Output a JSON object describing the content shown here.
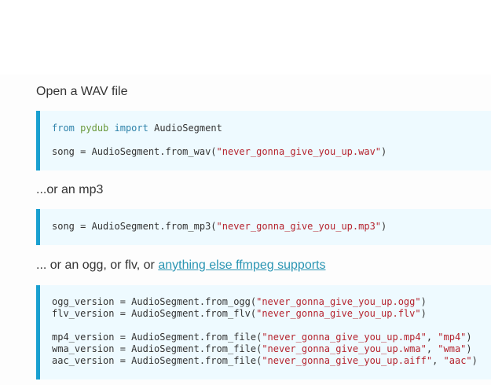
{
  "sections": [
    {
      "intro": "Open a WAV file",
      "code": {
        "kw_from": "from",
        "module": "pydub",
        "kw_import": "import",
        "imported_name": "AudioSegment",
        "line2_prefix": "song = AudioSegment.from_wav(",
        "line2_str": "\"never_gonna_give_you_up.wav\"",
        "line2_suffix": ")"
      }
    },
    {
      "intro": "...or an mp3",
      "code": {
        "line1_prefix": "song = AudioSegment.from_mp3(",
        "line1_str": "\"never_gonna_give_you_up.mp3\"",
        "line1_suffix": ")"
      }
    },
    {
      "intro": "... or an ogg, or flv, or ",
      "link_text": "anything else ffmpeg supports",
      "code": {
        "lines": [
          {
            "prefix": "ogg_version = AudioSegment.from_ogg(",
            "str1": "\"never_gonna_give_you_up.ogg\"",
            "mid": "",
            "str2": "",
            "suffix": ")"
          },
          {
            "prefix": "flv_version = AudioSegment.from_flv(",
            "str1": "\"never_gonna_give_you_up.flv\"",
            "mid": "",
            "str2": "",
            "suffix": ")"
          },
          {
            "prefix": "mp4_version = AudioSegment.from_file(",
            "str1": "\"never_gonna_give_you_up.mp4\"",
            "mid": ", ",
            "str2": "\"mp4\"",
            "suffix": ")"
          },
          {
            "prefix": "wma_version = AudioSegment.from_file(",
            "str1": "\"never_gonna_give_you_up.wma\"",
            "mid": ", ",
            "str2": "\"wma\"",
            "suffix": ")"
          },
          {
            "prefix": "aac_version = AudioSegment.from_file(",
            "str1": "\"never_gonna_give_you_up.aiff\"",
            "mid": ", ",
            "str2": "\"aac\"",
            "suffix": ")"
          }
        ]
      }
    }
  ],
  "colors": {
    "code_background": "#eefaff",
    "code_border": "#1aa0d0",
    "keyword": "#2e82aa",
    "module": "#6b9a3e",
    "string": "#b5232e",
    "link": "#2a95b3"
  }
}
